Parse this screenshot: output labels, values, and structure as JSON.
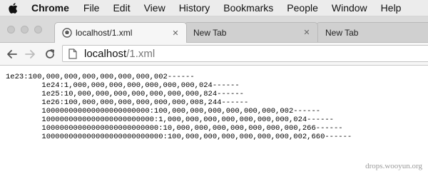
{
  "menubar": {
    "app_name": "Chrome",
    "items": [
      "File",
      "Edit",
      "View",
      "History",
      "Bookmarks",
      "People",
      "Window",
      "Help"
    ]
  },
  "tabs": [
    {
      "title": "localhost/1.xml",
      "active": true,
      "close": "✕"
    },
    {
      "title": "New Tab",
      "active": false,
      "close": "✕"
    },
    {
      "title": "New Tab",
      "active": false
    }
  ],
  "omnibox": {
    "host": "localhost",
    "path": "/1.xml"
  },
  "content": {
    "lines": [
      "1e23:100,000,000,000,000,000,000,002------",
      "        1e24:1,000,000,000,000,000,000,000,024------",
      "        1e25:10,000,000,000,000,000,000,000,824------",
      "        1e26:100,000,000,000,000,000,000,008,244------",
      "        100000000000000000000000:100,000,000,000,000,000,000,002------",
      "        1000000000000000000000000:1,000,000,000,000,000,000,000,024------",
      "        10000000000000000000000000:10,000,000,000,000,000,000,000,266------",
      "        100000000000000000000000000:100,000,000,000,000,000,000,002,660------"
    ]
  },
  "watermark": "drops.wooyun.org",
  "colors": {
    "menubar": "#ececec",
    "tabstrip": "#dadada",
    "active_tab": "#f6f6f6",
    "inactive_tab": "#d0d0d0"
  }
}
